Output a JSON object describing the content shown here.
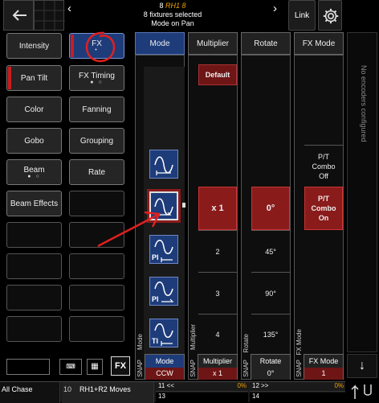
{
  "header": {
    "line1_num": "8",
    "line1_name": "RH1 8",
    "line2": "8 fixtures selected",
    "line3": "Mode on Pan",
    "link": "Link"
  },
  "features": [
    {
      "label": "Intensity"
    },
    {
      "label": "FX",
      "sub": "•"
    },
    {
      "label": "Pan Tilt"
    },
    {
      "label": "FX Timing",
      "sub": "● ○"
    },
    {
      "label": "Color"
    },
    {
      "label": "Fanning"
    },
    {
      "label": "Gobo"
    },
    {
      "label": "Grouping"
    },
    {
      "label": "Beam",
      "sub": "● ○"
    },
    {
      "label": "Rate"
    },
    {
      "label": "Beam Effects"
    }
  ],
  "columns": {
    "mode": {
      "title": "Mode",
      "snap": "SNAP",
      "side": "Mode",
      "footer_label": "Mode",
      "footer_value": "CCW"
    },
    "multiplier": {
      "title": "Multiplier",
      "default": "Default",
      "selected": "x 1",
      "values": [
        "2",
        "3",
        "4"
      ],
      "snap": "SNAP",
      "side": "Multiplier",
      "footer_label": "Multiplier",
      "footer_value": "x 1"
    },
    "rotate": {
      "title": "Rotate",
      "selected": "0°",
      "values": [
        "45°",
        "90°",
        "135°"
      ],
      "snap": "SNAP",
      "side": "Rotate",
      "footer_label": "Rotate",
      "footer_value": "0°"
    },
    "fxmode": {
      "title": "FX Mode",
      "off": "P/T\nCombo\nOff",
      "on": "P/T\nCombo\nOn",
      "snap": "SNAP",
      "side": "FX Mode",
      "footer_label": "FX Mode",
      "footer_value": "1"
    }
  },
  "encoders_text": "No encoders configured",
  "wave_labels": [
    "",
    "",
    "PI",
    "PI",
    "TI"
  ],
  "bottom": {
    "fx_btn": "FX",
    "chase": "All Chase",
    "p10": "10",
    "moves": "RH1+R2 Moves",
    "p11": "11 <<",
    "p11pct": "0%",
    "p12": "12 >>",
    "p12pct": "0%",
    "p13": "13",
    "p14": "14"
  },
  "colors": {
    "accent": "#c81e1e",
    "blue": "#1e3c7a",
    "orange": "#f0a000"
  }
}
